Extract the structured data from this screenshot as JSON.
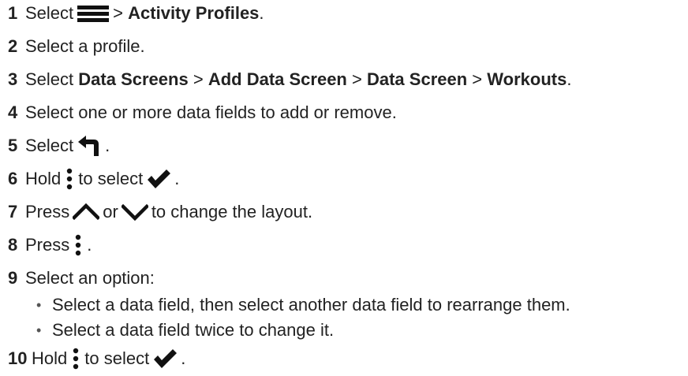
{
  "steps": [
    {
      "num": "1",
      "select": "Select",
      "sep": ">",
      "item": "Activity Profiles",
      "end": ".",
      "icon": "menu-icon"
    },
    {
      "num": "2",
      "text": "Select a profile."
    },
    {
      "num": "3",
      "select": "Select",
      "a": "Data Screens",
      "b": "Add Data Screen",
      "c": "Data Screen",
      "d": "Workouts",
      "sep": ">",
      "end": "."
    },
    {
      "num": "4",
      "text": "Select one or more data fields to add or remove."
    },
    {
      "num": "5",
      "select": "Select",
      "end": ".",
      "icon": "back-icon"
    },
    {
      "num": "6",
      "hold": "Hold",
      "mid": "to select",
      "end": ".",
      "icons": [
        "more-dots-icon",
        "checkmark-icon"
      ]
    },
    {
      "num": "7",
      "press": "Press",
      "or": "or",
      "rest": "to change the layout.",
      "icons": [
        "up-chevron-icon",
        "down-chevron-icon"
      ]
    },
    {
      "num": "8",
      "press": "Press",
      "end": ".",
      "icon": "more-dots-icon"
    },
    {
      "num": "9",
      "text": "Select an option:"
    },
    {
      "num": "10",
      "hold": "Hold",
      "mid": "to select",
      "end": ".",
      "icons": [
        "more-dots-icon",
        "checkmark-icon"
      ]
    }
  ],
  "bullets": [
    {
      "mark": "•",
      "text": "Select a data field, then select another data field to rearrange them."
    },
    {
      "mark": "•",
      "text": "Select a data field twice to change it."
    }
  ]
}
